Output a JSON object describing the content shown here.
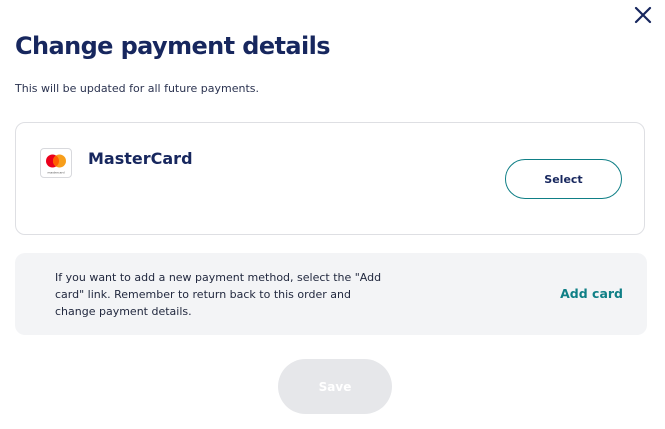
{
  "dialog": {
    "title": "Change payment details",
    "subtitle": "This will be updated for all future payments.",
    "close_icon": "close-icon"
  },
  "payment_methods": [
    {
      "name": "MasterCard",
      "logo_icon": "mastercard-logo-icon",
      "logo_text": "mastercard",
      "select_label": "Select"
    }
  ],
  "info": {
    "text": "If you want to add a new payment method, select the \"Add card\" link. Remember to return back to this order and change payment details.",
    "add_card_label": "Add card"
  },
  "actions": {
    "save_label": "Save",
    "save_disabled": true
  },
  "colors": {
    "title": "#17275e",
    "accent": "#0f7f86",
    "info_background": "#f3f4f6",
    "card_border": "#dedfe3",
    "save_disabled_bg": "#e6e7ea",
    "mastercard_red": "#eb001b",
    "mastercard_orange": "#f79e1b",
    "mastercard_overlap": "#ff5f00"
  }
}
